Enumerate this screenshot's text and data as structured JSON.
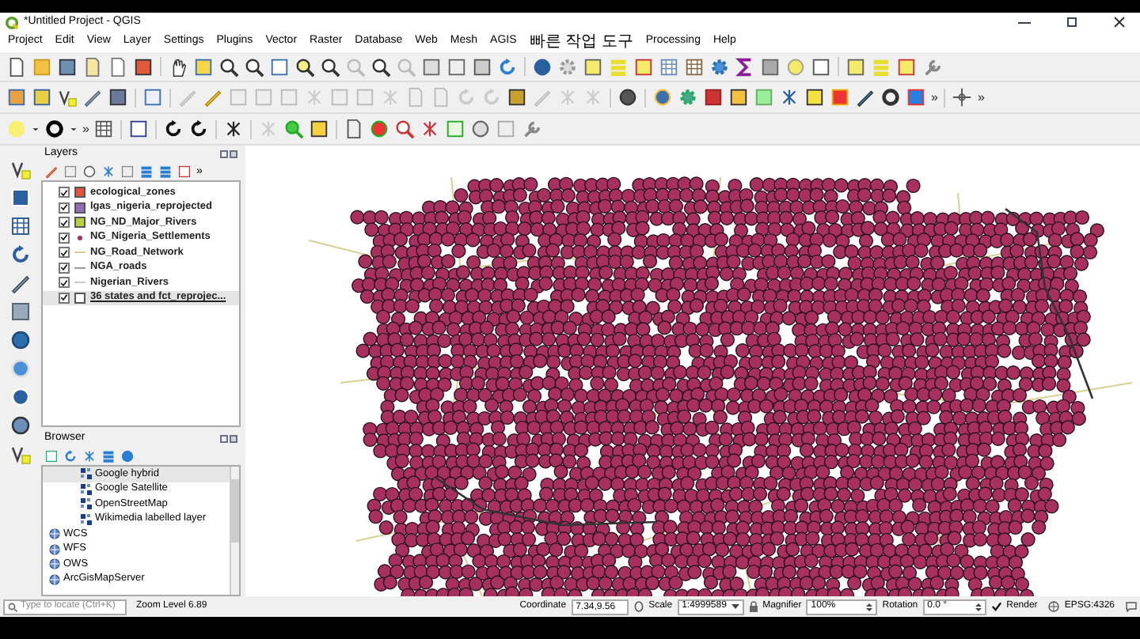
{
  "window": {
    "title": "*Untitled Project - QGIS"
  },
  "menu": [
    "Project",
    "Edit",
    "View",
    "Layer",
    "Settings",
    "Plugins",
    "Vector",
    "Raster",
    "Database",
    "Web",
    "Mesh",
    "AGIS",
    "빠른 작업 도구",
    "Processing",
    "Help"
  ],
  "toolbar_overflow_marks": [
    "»",
    "»",
    "»"
  ],
  "layers_panel": {
    "title": "Layers",
    "overflow": "»",
    "layers": [
      {
        "name": "ecological_zones",
        "checked": true,
        "kind": "polygon",
        "color": "#e0533c",
        "selected": false
      },
      {
        "name": "lgas_nigeria_reprojected",
        "checked": true,
        "kind": "polygon",
        "color": "#8e6fb8",
        "selected": false
      },
      {
        "name": "NG_ND_Major_Rivers",
        "checked": true,
        "kind": "polygon",
        "color": "#b8cf3e",
        "selected": false
      },
      {
        "name": "NG_Nigeria_Settlements",
        "checked": true,
        "kind": "point",
        "color": "#a3305f",
        "selected": false
      },
      {
        "name": "NG_Road_Network",
        "checked": true,
        "kind": "line",
        "color": "#d9cf8a",
        "selected": false
      },
      {
        "name": "NGA_roads",
        "checked": true,
        "kind": "line",
        "color": "#9a9a9a",
        "selected": false
      },
      {
        "name": "Nigerian_Rivers",
        "checked": true,
        "kind": "line",
        "color": "#c8c8d8",
        "selected": false
      },
      {
        "name": "36 states and fct_reprojec...",
        "checked": true,
        "kind": "polygon",
        "color": "#ffffff",
        "selected": true
      }
    ]
  },
  "browser_panel": {
    "title": "Browser",
    "items": [
      {
        "children": [
          {
            "label": "Google hybrid",
            "kind": "tile",
            "selected": true
          },
          {
            "label": "Google Satellite",
            "kind": "tile",
            "selected": false
          },
          {
            "label": "OpenStreetMap",
            "kind": "tile",
            "selected": false
          },
          {
            "label": "Wikimedia labelled layer",
            "kind": "tile",
            "selected": false
          }
        ]
      },
      {
        "label": "WCS",
        "kind": "service",
        "selected": false
      },
      {
        "label": "WFS",
        "kind": "service",
        "selected": false
      },
      {
        "label": "OWS",
        "kind": "service",
        "selected": false
      },
      {
        "label": "ArcGisMapServer",
        "kind": "service",
        "selected": false
      }
    ]
  },
  "status_bar": {
    "locator_placeholder": "Type to locate (Ctrl+K)",
    "zoom_level": "Zoom Level 6.89",
    "coordinate_label": "Coordinate",
    "coordinate": "7.34,9.56",
    "scale_label": "Scale",
    "scale": "1:4999589",
    "magnifier_label": "Magnifier",
    "magnifier": "100%",
    "rotation_label": "Rotation",
    "rotation": "0.0 °",
    "render_label": "Render",
    "render_checked": true,
    "crs": "EPSG:4326"
  }
}
